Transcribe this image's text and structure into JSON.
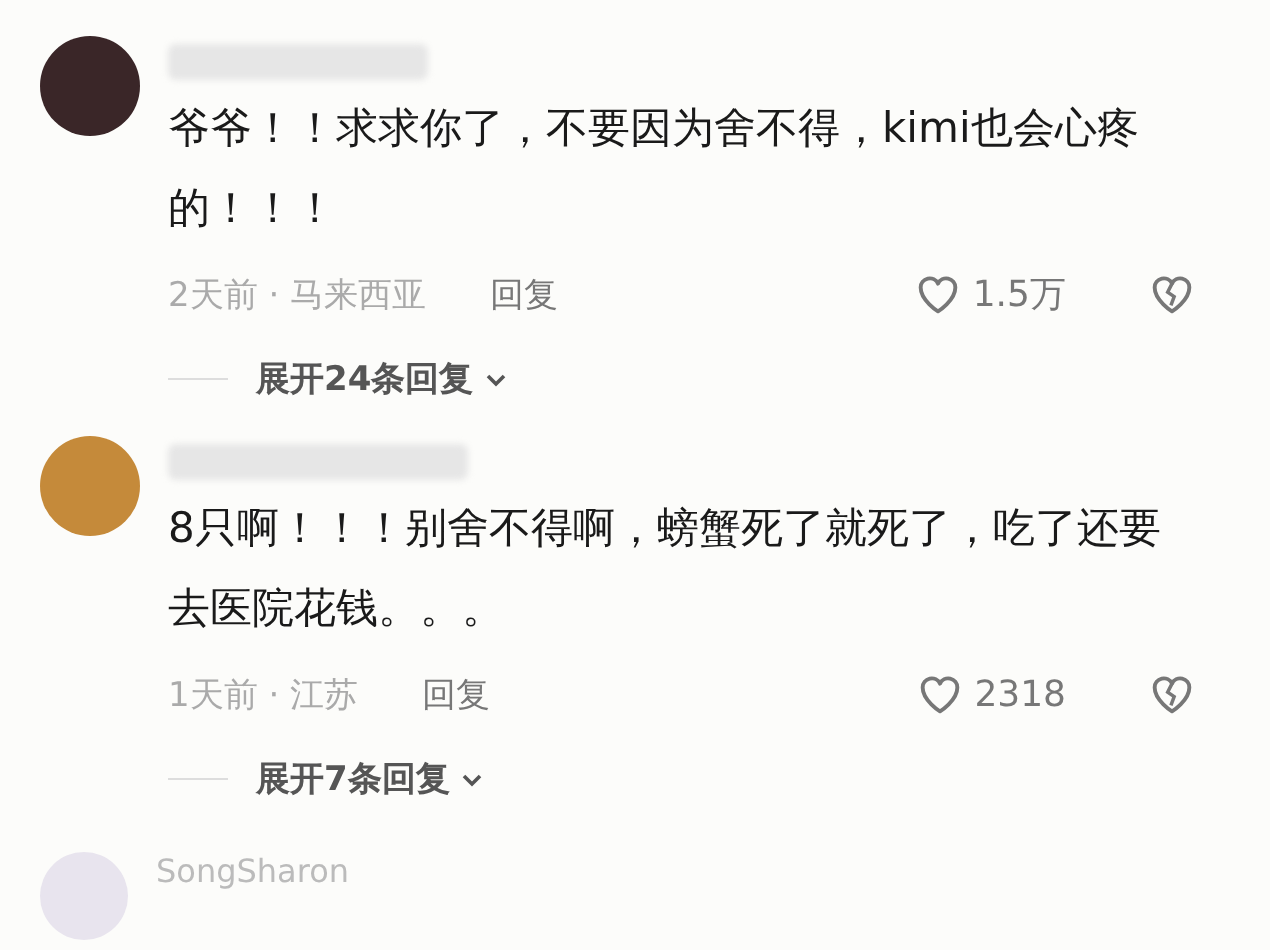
{
  "comments": [
    {
      "text": "爷爷！！求求你了，不要因为舍不得，kimi也会心疼的！！！",
      "meta": "2天前 · 马来西亚",
      "reply": "回复",
      "likes": "1.5万",
      "expand": "展开24条回复"
    },
    {
      "text": "8只啊！！！别舍不得啊，螃蟹死了就死了，吃了还要去医院花钱。。。",
      "meta": "1天前 · 江苏",
      "reply": "回复",
      "likes": "2318",
      "expand": "展开7条回复"
    }
  ],
  "next_comment": {
    "username": "SongSharon"
  }
}
